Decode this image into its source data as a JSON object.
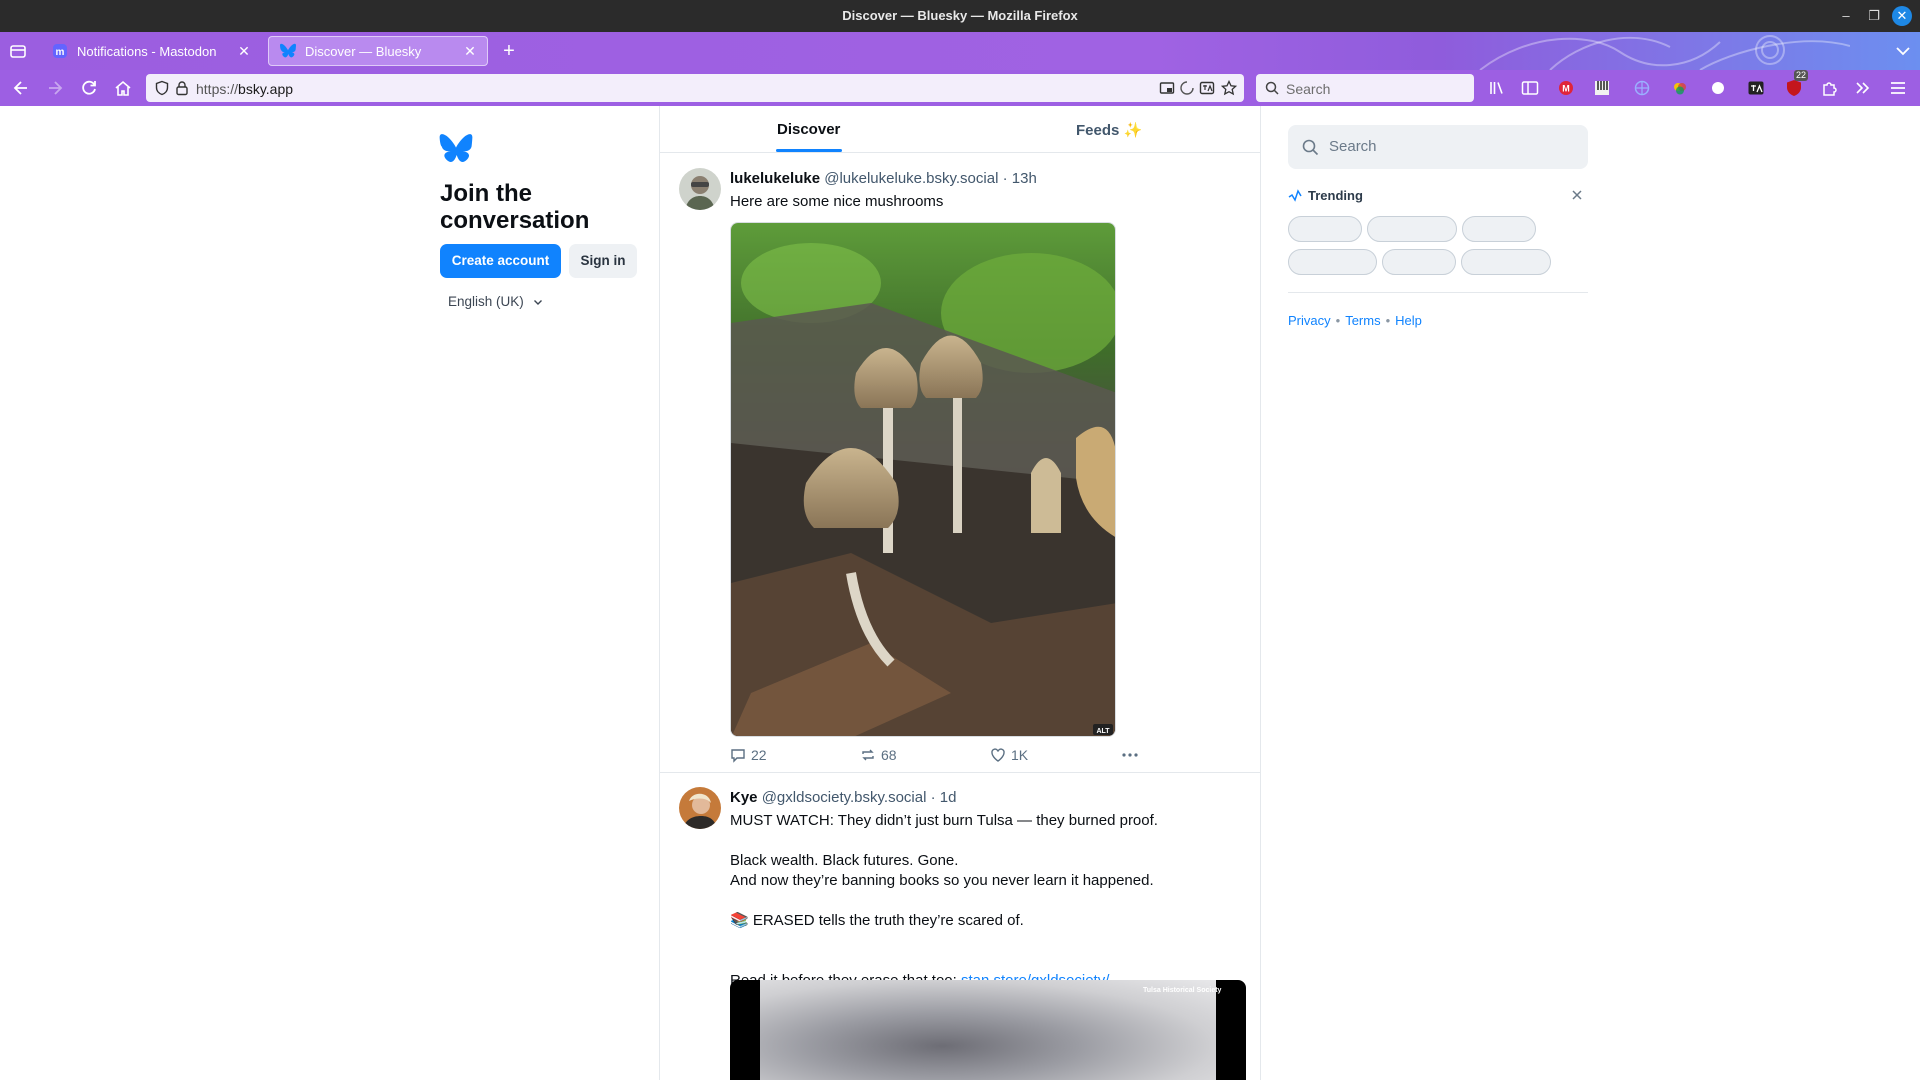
{
  "window": {
    "title": "Discover — Bluesky — Mozilla Firefox"
  },
  "tabs": [
    {
      "label": "Notifications - Mastodon",
      "active": false,
      "favicon": "mastodon-icon"
    },
    {
      "label": "Discover — Bluesky",
      "active": true,
      "favicon": "bluesky-butterfly-icon"
    }
  ],
  "navbar": {
    "url_protocol": "https://",
    "url_host": "bsky.app",
    "search_placeholder": "Search",
    "extension_badge": "22"
  },
  "sidebar": {
    "heading": "Join the conversation",
    "create_account": "Create account",
    "sign_in": "Sign in",
    "language": "English (UK)"
  },
  "feed": {
    "tabs": [
      "Discover",
      "Feeds ✨"
    ],
    "active_tab": "Discover",
    "posts": [
      {
        "name": "lukelukeluke",
        "handle": "@lukelukeluke.bsky.social",
        "time": "· 13h",
        "text": "Here are some nice mushrooms",
        "alt_badge": "ALT",
        "replies": "22",
        "reposts": "68",
        "likes": "1K"
      },
      {
        "name": "Kye",
        "handle": "@gxldsociety.bsky.social",
        "time": "· 1d",
        "line1": "MUST WATCH: They didn’t just burn Tulsa — they burned proof.",
        "line2": "Black wealth. Black futures. Gone.",
        "line3": "And now they’re banning books so you never learn it happened.",
        "line4": "📚 ERASED tells the truth they’re scared of.",
        "line5_prefix": "Read it before they erase that too: ",
        "line5_link": "stan.store/gxldsociety/...",
        "image_caption": "Tulsa Historical Society"
      }
    ]
  },
  "right": {
    "search_placeholder": "Search",
    "trending_title": "Trending",
    "links": [
      "Privacy",
      "Terms",
      "Help"
    ]
  },
  "colors": {
    "accent": "#1083fe",
    "tabstrip": "#9b5ee0",
    "text": "#0b0f14",
    "muted": "#42576c"
  }
}
